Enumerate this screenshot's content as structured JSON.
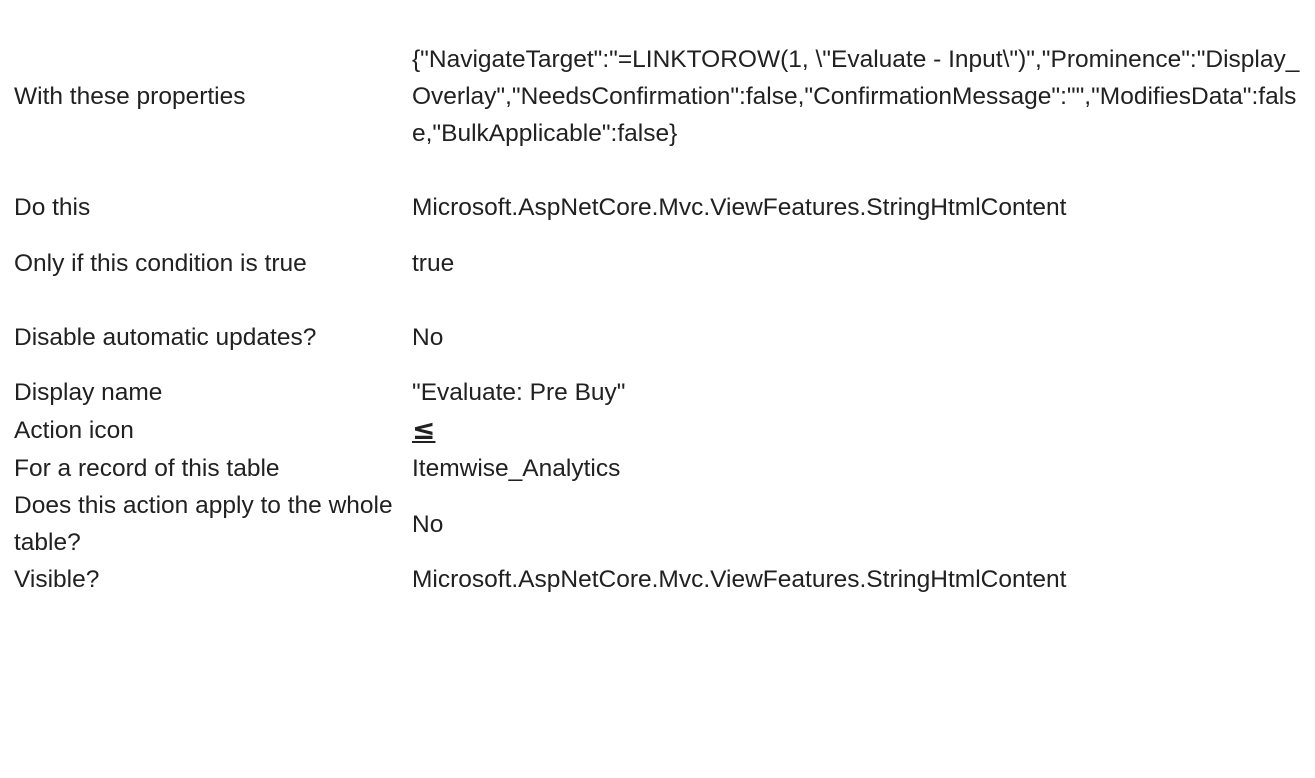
{
  "properties": {
    "rows": [
      {
        "label": "With these properties",
        "value": "{\"NavigateTarget\":\"=LINKTOROW(1, \\\"Evaluate - Input\\\")\",\"Prominence\":\"Display_Overlay\",\"NeedsConfirmation\":false,\"ConfirmationMessage\":\"\",\"ModifiesData\":false,\"BulkApplicable\":false}"
      },
      {
        "label": "Do this",
        "value": "Microsoft.AspNetCore.Mvc.ViewFeatures.StringHtmlContent"
      },
      {
        "label": "Only if this condition is true",
        "value": "true"
      },
      {
        "label": "Disable automatic updates?",
        "value": "No"
      },
      {
        "label": "Display name",
        "value": "\"Evaluate: Pre Buy\""
      },
      {
        "label": "Action icon",
        "value": "≤",
        "icon_name": "less-than-or-equal-icon"
      },
      {
        "label": "For a record of this table",
        "value": "Itemwise_Analytics"
      },
      {
        "label": "Does this action apply to the whole table?",
        "value": "No"
      },
      {
        "label": "Visible?",
        "value": "Microsoft.AspNetCore.Mvc.ViewFeatures.StringHtmlContent"
      }
    ]
  }
}
